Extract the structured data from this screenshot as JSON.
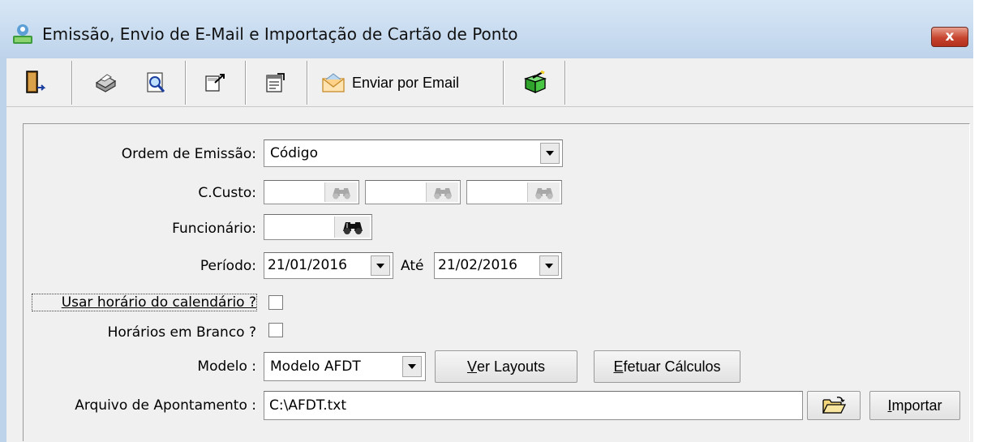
{
  "window": {
    "title": "Emissão, Envio de E-Mail e Importação de Cartão de Ponto",
    "close_label": "x"
  },
  "toolbar": {
    "items": [
      {
        "icon": "exit-door-icon"
      },
      {
        "icon": "printer-icon"
      },
      {
        "icon": "print-preview-icon"
      },
      {
        "icon": "setup-icon"
      },
      {
        "icon": "properties-icon"
      },
      {
        "icon": "email-envelope-icon",
        "label": "Enviar por Email"
      },
      {
        "icon": "green-box-icon"
      }
    ]
  },
  "form": {
    "ordem_label": "Ordem de Emissão:",
    "ordem_value": "Código",
    "ccusto_label": "C.Custo:",
    "ccusto_values": [
      "",
      "",
      ""
    ],
    "funcionario_label": "Funcionário:",
    "funcionario_value": "",
    "periodo_label": "Período:",
    "periodo_inicio": "21/01/2016",
    "ate_label": "Até",
    "periodo_fim": "21/02/2016",
    "usar_horario_label": "Usar horário do calendário ?",
    "usar_horario_checked": false,
    "horarios_branco_label": "Horários em Branco ?",
    "horarios_branco_checked": false,
    "modelo_label": "Modelo :",
    "modelo_value": "Modelo AFDT",
    "ver_layouts_rest": "er Layouts",
    "ver_layouts_key": "V",
    "efetuar_rest": "fetuar Cálculos",
    "efetuar_key": "E",
    "arquivo_label": "Arquivo de Apontamento :",
    "arquivo_value": "C:\\AFDT.txt",
    "importar_key": "I",
    "importar_rest": "mportar"
  },
  "colors": {
    "titlebar": "#c9dcf0",
    "close_button": "#c7452f",
    "window_bg": "#f0f0f0"
  }
}
